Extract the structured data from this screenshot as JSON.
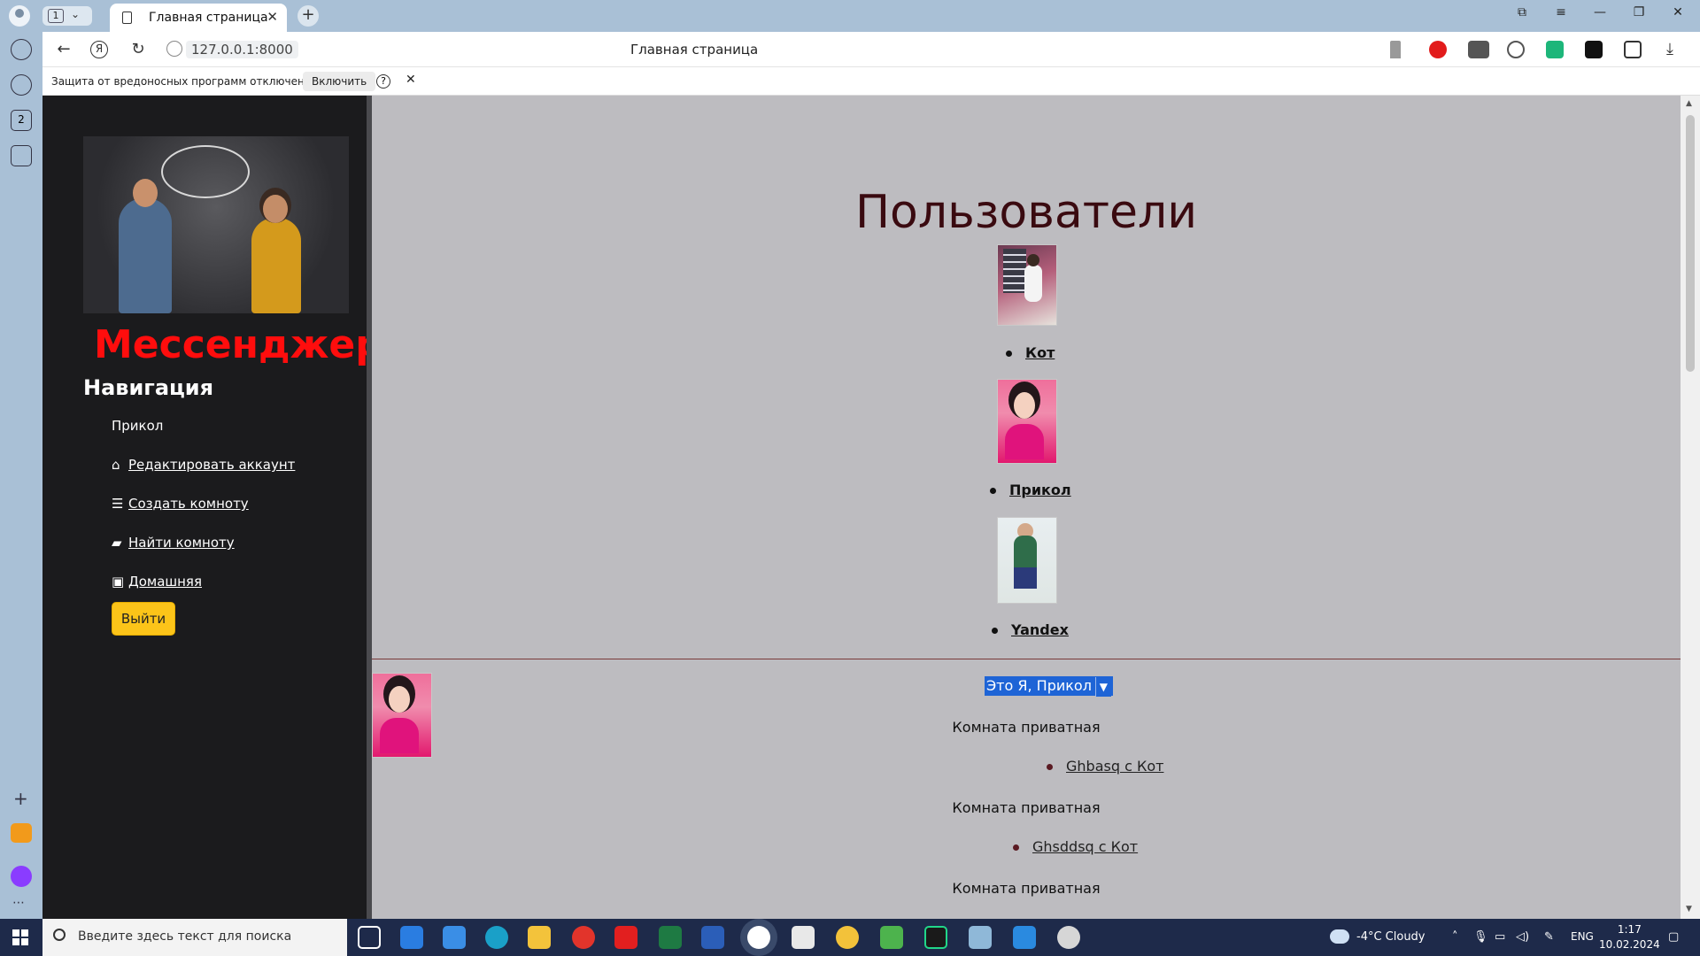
{
  "browser": {
    "tab_count": "1",
    "tab_title": "Главная страница",
    "url": "127.0.0.1:8000",
    "page_title": "Главная страница",
    "infobar": {
      "message": "Защита от вредоносных программ отключена",
      "enable_label": "Включить",
      "help_label": "?"
    },
    "sidebar_badge": "2"
  },
  "site": {
    "brand": "Мессенджер",
    "nav_title": "Навигация",
    "current_user": "Прикол",
    "nav_items": [
      {
        "label": "Редактировать аккаунт",
        "icon": "home-icon"
      },
      {
        "label": "Создать комноту",
        "icon": "list-icon"
      },
      {
        "label": "Найти комноту",
        "icon": "comment-icon"
      },
      {
        "label": "Домашняя",
        "icon": "image-icon"
      }
    ],
    "logout_label": "Выйти"
  },
  "main": {
    "users_title": "Пользователи",
    "users": [
      {
        "name": "Кот"
      },
      {
        "name": "Прикол"
      },
      {
        "name": "Yandex"
      }
    ],
    "selected_room": "Это Я, Прикол",
    "rooms": [
      {
        "type_label": "Комната приватная",
        "link": "Ghbasq с Кот"
      },
      {
        "type_label": "Комната приватная",
        "link": "Ghsddsq с Кот"
      },
      {
        "type_label": "Комната приватная",
        "link": ""
      }
    ]
  },
  "taskbar": {
    "search_placeholder": "Введите здесь текст для поиска",
    "weather": "-4°C  Cloudy",
    "language": "ENG",
    "time": "1:17",
    "date": "10.02.2024"
  },
  "colors": {
    "brand_red": "#ff0d0d",
    "sidebar_bg": "#1b1b1d",
    "main_bg": "#bdbcc0",
    "logout_yellow": "#fcc419",
    "title_dark_red": "#3a0a10",
    "combo_blue": "#1e64d6"
  }
}
